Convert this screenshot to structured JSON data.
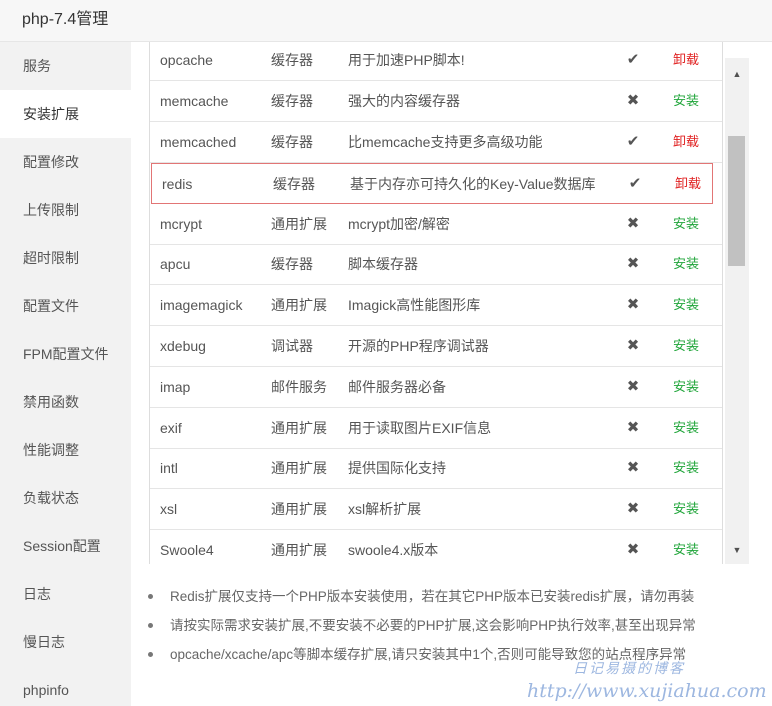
{
  "window": {
    "title": "php-7.4管理"
  },
  "sidebar": {
    "items": [
      {
        "label": "服务"
      },
      {
        "label": "安装扩展",
        "active": true
      },
      {
        "label": "配置修改"
      },
      {
        "label": "上传限制"
      },
      {
        "label": "超时限制"
      },
      {
        "label": "配置文件"
      },
      {
        "label": "FPM配置文件"
      },
      {
        "label": "禁用函数"
      },
      {
        "label": "性能调整"
      },
      {
        "label": "负载状态"
      },
      {
        "label": "Session配置"
      },
      {
        "label": "日志"
      },
      {
        "label": "慢日志"
      },
      {
        "label": "phpinfo"
      }
    ]
  },
  "extensions": [
    {
      "name": "opcache",
      "type": "缓存器",
      "desc": "用于加速PHP脚本!",
      "status": "✔",
      "action": "卸载"
    },
    {
      "name": "memcache",
      "type": "缓存器",
      "desc": "强大的内容缓存器",
      "status": "✖",
      "action": "安装"
    },
    {
      "name": "memcached",
      "type": "缓存器",
      "desc": "比memcache支持更多高级功能",
      "status": "✔",
      "action": "卸载"
    },
    {
      "name": "redis",
      "type": "缓存器",
      "desc": "基于内存亦可持久化的Key-Value数据库",
      "status": "✔",
      "action": "卸载"
    },
    {
      "name": "mcrypt",
      "type": "通用扩展",
      "desc": "mcrypt加密/解密",
      "status": "✖",
      "action": "安装"
    },
    {
      "name": "apcu",
      "type": "缓存器",
      "desc": "脚本缓存器",
      "status": "✖",
      "action": "安装"
    },
    {
      "name": "imagemagick",
      "type": "通用扩展",
      "desc": "Imagick高性能图形库",
      "status": "✖",
      "action": "安装"
    },
    {
      "name": "xdebug",
      "type": "调试器",
      "desc": "开源的PHP程序调试器",
      "status": "✖",
      "action": "安装"
    },
    {
      "name": "imap",
      "type": "邮件服务",
      "desc": "邮件服务器必备",
      "status": "✖",
      "action": "安装"
    },
    {
      "name": "exif",
      "type": "通用扩展",
      "desc": "用于读取图片EXIF信息",
      "status": "✖",
      "action": "安装"
    },
    {
      "name": "intl",
      "type": "通用扩展",
      "desc": "提供国际化支持",
      "status": "✖",
      "action": "安装"
    },
    {
      "name": "xsl",
      "type": "通用扩展",
      "desc": "xsl解析扩展",
      "status": "✖",
      "action": "安装"
    },
    {
      "name": "Swoole4",
      "type": "通用扩展",
      "desc": "swoole4.x版本",
      "status": "✖",
      "action": "安装"
    }
  ],
  "notes": [
    "Redis扩展仅支持一个PHP版本安装使用，若在其它PHP版本已安装redis扩展，请勿再装",
    "请按实际需求安装扩展,不要安装不必要的PHP扩展,这会影响PHP执行效率,甚至出现异常",
    "opcache/xcache/apc等脚本缓存扩展,请只安装其中1个,否则可能导致您的站点程序异常"
  ],
  "watermark": {
    "line1": "日记易摄的博客",
    "line2": "http://www.xujiahua.com"
  },
  "colors": {
    "install": "#20a53a",
    "uninstall": "#e02020",
    "highlight_border": "#e27575"
  }
}
